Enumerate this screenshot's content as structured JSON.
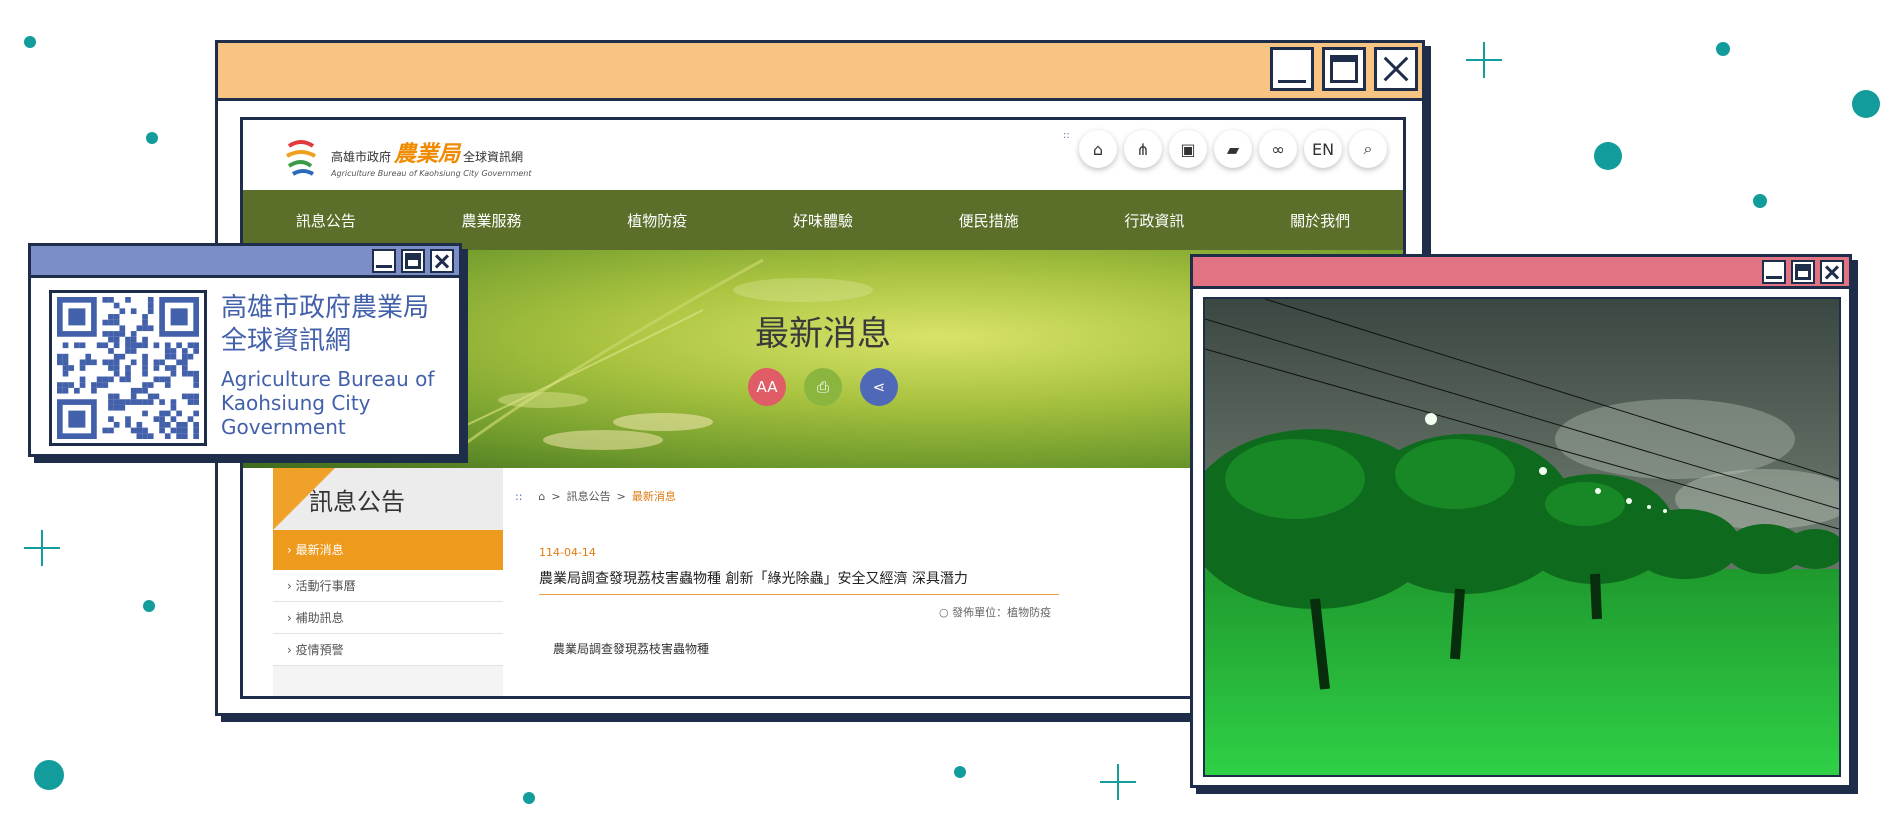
{
  "colors": {
    "teal": "#129c9c",
    "navy": "#1e2d4a",
    "main_titlebar": "#f7c483",
    "qr_titlebar": "#7b8ec8",
    "photo_titlebar": "#e27382",
    "nav_green": "#5b6e2a",
    "active_orange": "#ee9a1c",
    "qr_text_blue": "#4361aa"
  },
  "site": {
    "logo": {
      "prefix": "高雄市政府",
      "name": "農業局",
      "suffix": "全球資訊網",
      "english": "Agriculture Bureau of Kaohsiung City Government"
    },
    "header_icons": [
      {
        "name": "home-icon",
        "glyph": "⌂"
      },
      {
        "name": "sitemap-icon",
        "glyph": "⋔"
      },
      {
        "name": "accessibility-icon",
        "glyph": "▣"
      },
      {
        "name": "folder-icon",
        "glyph": "▰"
      },
      {
        "name": "link-icon",
        "glyph": "∞"
      },
      {
        "name": "language-toggle",
        "label": "EN"
      },
      {
        "name": "search-icon",
        "glyph": "⌕"
      }
    ],
    "header_grip": "::",
    "nav": [
      "訊息公告",
      "農業服務",
      "植物防疫",
      "好味體驗",
      "便民措施",
      "行政資訊",
      "關於我們"
    ],
    "banner": {
      "title": "最新消息",
      "buttons": [
        {
          "name": "font-size-icon",
          "label": "AA",
          "color": "#e05c66"
        },
        {
          "name": "print-icon",
          "label": "⎙",
          "color": "#8ab640"
        },
        {
          "name": "share-icon",
          "label": "⋖",
          "color": "#5068b8"
        }
      ]
    },
    "sidebar": {
      "title": "訊息公告",
      "active": "最新消息",
      "items": [
        "活動行事曆",
        "補助訊息",
        "疫情預警"
      ]
    },
    "breadcrumb": {
      "grip": "::",
      "home": "⌂",
      "sep": ">",
      "section": "訊息公告",
      "current": "最新消息"
    },
    "article": {
      "date": "114-04-14",
      "title": "農業局調查發現荔枝害蟲物種 創新「綠光除蟲」安全又經濟 深具潛力",
      "unit": "發佈單位：植物防疫",
      "body": "農業局調查發現荔枝害蟲物種"
    }
  },
  "qr_card": {
    "title_lines": [
      "高雄市政府農業局",
      "全球資訊網"
    ],
    "english_lines": [
      "Agriculture Bureau of",
      "Kaohsiung City",
      "Government"
    ]
  },
  "photo": {
    "subject": "orchard-under-green-lights"
  }
}
